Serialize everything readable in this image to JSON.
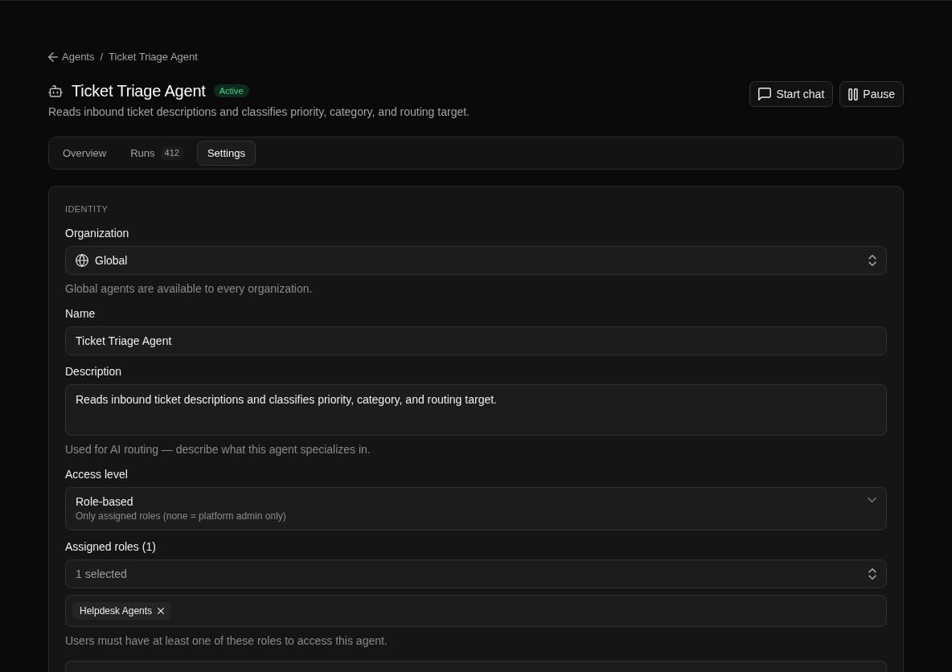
{
  "breadcrumb": {
    "back_label": "Agents",
    "separator": "/",
    "current": "Ticket Triage Agent"
  },
  "header": {
    "title": "Ticket Triage Agent",
    "status": {
      "label": "Active",
      "kind": "active"
    },
    "description": "Reads inbound ticket descriptions and classifies priority, category, and routing target."
  },
  "actions": [
    {
      "label": "Start chat",
      "kind": "chat"
    },
    {
      "label": "Pause",
      "kind": "pause"
    }
  ],
  "tabs": [
    {
      "label": "Overview",
      "selected": false
    },
    {
      "label": "Runs",
      "count": "412",
      "selected": false
    },
    {
      "label": "Settings",
      "selected": true
    }
  ],
  "settings": {
    "section_title": "IDENTITY",
    "fields": [
      {
        "kind": "organization",
        "label": "Organization",
        "value": "Global",
        "hint": "Global agents are available to every organization."
      },
      {
        "kind": "text",
        "label": "Name",
        "value": "Ticket Triage Agent"
      },
      {
        "kind": "textarea",
        "label": "Description",
        "value": "Reads inbound ticket descriptions and classifies priority, category, and routing target.",
        "hint": "Used for AI routing — describe what this agent specializes in."
      },
      {
        "kind": "access",
        "label": "Access level",
        "value": "Role-based",
        "detail": "Only assigned roles (none = platform admin only)"
      },
      {
        "kind": "roles",
        "label": "Assigned roles (1)",
        "summary": "1 selected",
        "chips": [
          {
            "label": "Helpdesk Agents"
          }
        ],
        "hint": "Users must have at least one of these roles to access this agent."
      }
    ]
  }
}
